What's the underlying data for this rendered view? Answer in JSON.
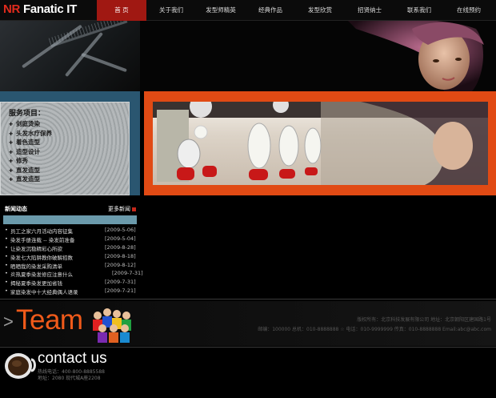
{
  "brand": {
    "prefix": "NR",
    "name": "Fanatic IT"
  },
  "nav": [
    {
      "label": "首  页",
      "active": true
    },
    {
      "label": "关于我们"
    },
    {
      "label": "发型师精英"
    },
    {
      "label": "经典作品"
    },
    {
      "label": "发型欣赏"
    },
    {
      "label": "招贤纳士"
    },
    {
      "label": "联系我们"
    },
    {
      "label": "在线预约"
    }
  ],
  "services": {
    "title": "服务项目：",
    "items": [
      "剑庭烫染",
      "头发水疗保养",
      "着色造型",
      "造型设计",
      "修秀",
      "直发造型",
      "直发造型"
    ]
  },
  "news": {
    "title": "新闻动态",
    "more": "更多新闻",
    "items": [
      {
        "title": "员工之家六月活动内容征集",
        "date": "[2009-5-06]"
      },
      {
        "title": "染发手册连载 -- 染发前准备",
        "date": "[2009-5-04]"
      },
      {
        "title": "让染发沉稳精彩心所欲",
        "date": "[2009-8-28]"
      },
      {
        "title": "染发七大陷阱教你破解招数",
        "date": "[2009-8-18]"
      },
      {
        "title": "晒晒我的染发采购清单",
        "date": "[2009-8-12]"
      },
      {
        "title": "炎热夏季染发修应注意什么",
        "date": "[2009-7-31]"
      },
      {
        "title": "揭秘夏季染发更加省钱",
        "date": "[2009-7-31]"
      },
      {
        "title": "家庭染发中十大经典偶人语录",
        "date": "[2009-7-21]"
      }
    ]
  },
  "team": {
    "arrow": ">",
    "word": "Team"
  },
  "footer": {
    "line1": "版权所有：北京科技发展有限公司    地址：北京朝阳区建国路1号",
    "line2": "邮编：100000    总机：010-8888888 ☆ 电话：010-9999999  传真：010-8888888  Email:abc@abc.com"
  },
  "contact": {
    "title": "contact us",
    "hotline": "热线电话：400-800-8885588",
    "address": "地址：2080 现代城A座2208"
  },
  "colors": {
    "accent": "#e14a14",
    "brand_red": "#e12b1d",
    "nav_active": "#a01812",
    "panel_blue": "#2a5670"
  }
}
